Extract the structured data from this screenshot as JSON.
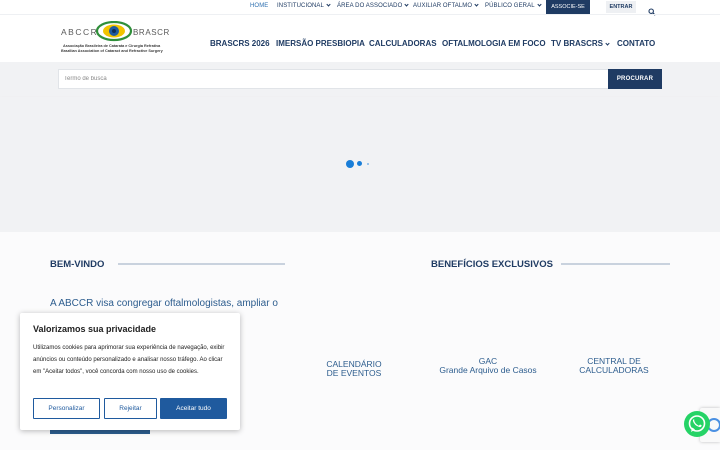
{
  "topbar": {
    "items": [
      {
        "label": "HOME",
        "active": true
      },
      {
        "label": "INSTITUCIONAL"
      },
      {
        "label": "ÁREA DO ASSOCIADO"
      },
      {
        "label": "AUXILIAR OFTALMO"
      },
      {
        "label": "PÚBLICO GERAL"
      }
    ],
    "associe_label": "ASSOCIE-SE",
    "entrar_label": "ENTRAR",
    "search_icon": "search-icon"
  },
  "logo": {
    "abccr": "ABCCR",
    "brascrs": "BRASCRS",
    "line1": "Associação Brasileira de Catarata e Cirurgia Refrativa",
    "line2": "Brazilian Association of Cataract and Refractive Surgery"
  },
  "nav": {
    "items": [
      {
        "label": "BRASCRS 2026"
      },
      {
        "label": "IMERSÃO PRESBIOPIA"
      },
      {
        "label": "CALCULADORAS"
      },
      {
        "label": "OFTALMOLOGIA EM FOCO"
      },
      {
        "label": "TV BRASCRS"
      },
      {
        "label": "CONTATO"
      }
    ]
  },
  "search": {
    "placeholder": "Termo de busca",
    "button_label": "PROCURAR"
  },
  "welcome": {
    "title": "BEM-VINDO",
    "text": "A ABCCR visa congregar oftalmologistas, ampliar o"
  },
  "benefits": {
    "title": "BENEFÍCIOS EXCLUSIVOS",
    "items": [
      {
        "line1": "CALENDÁRIO",
        "line2": "DE EVENTOS"
      },
      {
        "line1": "GAC",
        "line2": "Grande Arquivo de Casos"
      },
      {
        "line1": "CENTRAL DE",
        "line2": "CALCULADORAS"
      }
    ]
  },
  "cookie": {
    "title": "Valorizamos sua privacidade",
    "text": "Utilizamos cookies para aprimorar sua experiência de navegação, exibir anúncios ou conteúdo personalizado e analisar nosso tráfego. Ao clicar em \"Aceitar todos\", você concorda com nosso uso de cookies.",
    "customize_label": "Personalizar",
    "reject_label": "Rejeitar",
    "accept_label": "Aceitar tudo"
  },
  "colors": {
    "brand_navy": "#1f3b63",
    "brand_blue": "#2d5d8e",
    "loader_blue": "#1a7ed8",
    "whatsapp_green": "#25d366"
  }
}
